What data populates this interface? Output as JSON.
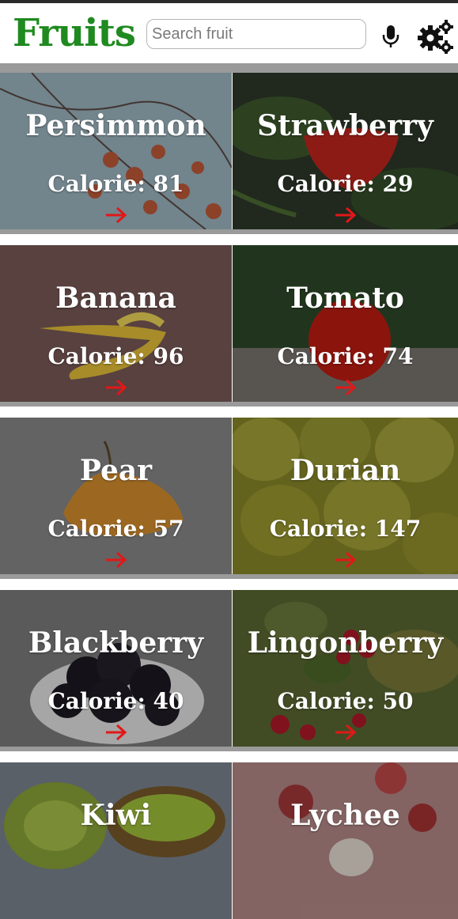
{
  "app": {
    "title": "Fruits"
  },
  "search": {
    "placeholder": "Search fruit"
  },
  "icons": {
    "mic": "microphone-icon",
    "settings": "gears-icon",
    "go": "arrow-right-icon"
  },
  "colors": {
    "title": "#1f8a1f",
    "arrow": "#e01818"
  },
  "calorie_label": "Calorie:",
  "fruits": [
    {
      "name": "Persimmon",
      "calorie": "81"
    },
    {
      "name": "Strawberry",
      "calorie": "29"
    },
    {
      "name": "Banana",
      "calorie": "96"
    },
    {
      "name": "Tomato",
      "calorie": "74"
    },
    {
      "name": "Pear",
      "calorie": "57"
    },
    {
      "name": "Durian",
      "calorie": "147"
    },
    {
      "name": "Blackberry",
      "calorie": "40"
    },
    {
      "name": "Lingonberry",
      "calorie": "50"
    },
    {
      "name": "Kiwi",
      "calorie": ""
    },
    {
      "name": "Lychee",
      "calorie": ""
    }
  ]
}
